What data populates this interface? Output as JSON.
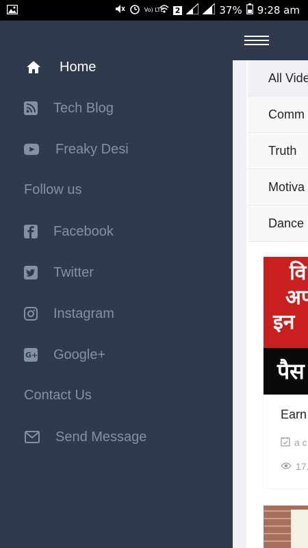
{
  "status_bar": {
    "battery": "37%",
    "time": "9:28 am",
    "sim_badge": "2",
    "network": "Vo) LTE"
  },
  "drawer": {
    "items": [
      {
        "label": "Home",
        "icon": "home-icon",
        "active": true
      },
      {
        "label": "Tech Blog",
        "icon": "rss-icon"
      },
      {
        "label": "Freaky Desi",
        "icon": "youtube-icon"
      }
    ],
    "follow_heading": "Follow us",
    "social": [
      {
        "label": "Facebook",
        "icon": "facebook-icon"
      },
      {
        "label": "Twitter",
        "icon": "twitter-icon"
      },
      {
        "label": "Instagram",
        "icon": "instagram-icon"
      },
      {
        "label": "Google+",
        "icon": "google-plus-icon"
      }
    ],
    "contact_heading": "Contact Us",
    "contact_items": [
      {
        "label": "Send Message",
        "icon": "envelope-icon"
      }
    ]
  },
  "main": {
    "categories": [
      "All Vide",
      "Comm",
      "Truth",
      "Motiva",
      "Dance"
    ],
    "card": {
      "thumb_lines": [
        "वि",
        "अप",
        "इन"
      ],
      "thumb_bottom": "पैस",
      "title": "Earn",
      "date_text": "a c",
      "views_text": "17."
    }
  },
  "colors": {
    "drawer_bg": "#2f3a4c",
    "drawer_text": "#8391a5",
    "active_text": "#ffffff",
    "thumb_red": "#c9201f"
  }
}
